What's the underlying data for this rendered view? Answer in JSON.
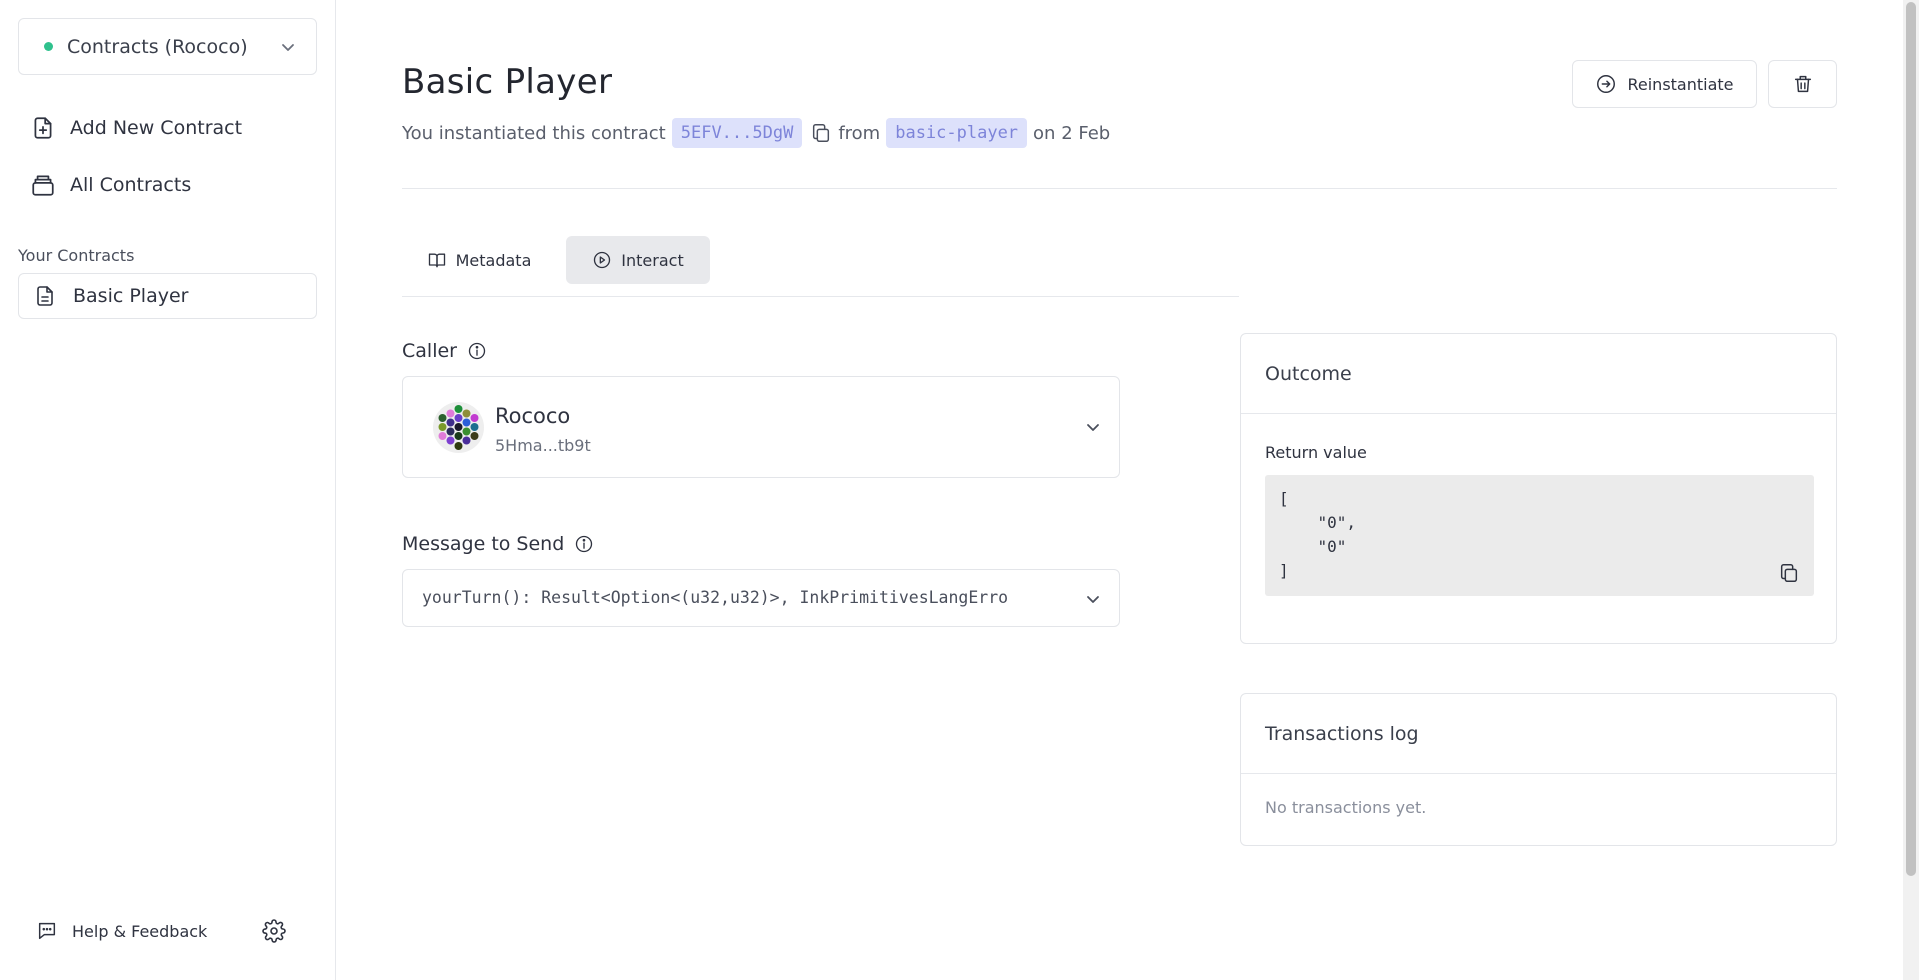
{
  "sidebar": {
    "network_label": "Contracts (Rococo)",
    "add_new_contract": "Add New Contract",
    "all_contracts": "All Contracts",
    "your_contracts_heading": "Your Contracts",
    "contracts": [
      {
        "name": "Basic Player"
      }
    ],
    "help_feedback": "Help & Feedback",
    "status_color": "#2fc18d"
  },
  "header": {
    "title": "Basic Player",
    "subtitle_prefix": "You instantiated this contract",
    "address": "5EFV...5DgW",
    "from_text": "from",
    "code_name": "basic-player",
    "date_text": "on 2 Feb",
    "reinstantiate_label": "Reinstantiate"
  },
  "tabs": [
    {
      "label": "Metadata",
      "icon": "book-icon",
      "active": false
    },
    {
      "label": "Interact",
      "icon": "play-circle-icon",
      "active": true
    }
  ],
  "interact": {
    "caller_label": "Caller",
    "caller": {
      "name": "Rococo",
      "address": "5Hma...tb9t"
    },
    "message_label": "Message to Send",
    "message": "yourTurn(): Result<Option<(u32,u32)>, InkPrimitivesLangErro"
  },
  "outcome": {
    "title": "Outcome",
    "return_label": "Return value",
    "return_value": "[\n    \"0\",\n    \"0\"\n]"
  },
  "transactions_log": {
    "title": "Transactions log",
    "empty_text": "No transactions yet."
  },
  "colors": {
    "accent_pill_bg": "#dde1fb",
    "accent_pill_text": "#7d84d9",
    "active_tab_bg": "#e8e9ec"
  }
}
